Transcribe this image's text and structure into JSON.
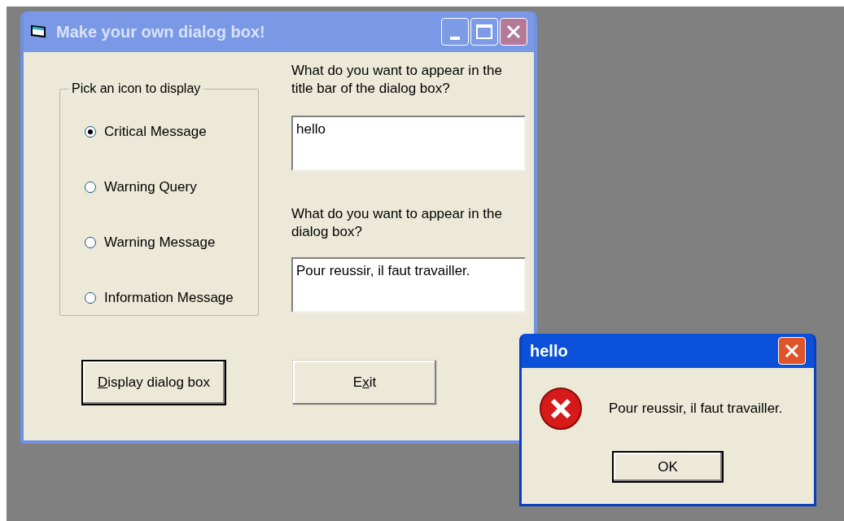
{
  "main_window": {
    "title": "Make your own dialog box!",
    "active": false,
    "group": {
      "legend": "Pick an icon to display",
      "options": [
        {
          "label": "Critical Message",
          "selected": true
        },
        {
          "label": "Warning Query",
          "selected": false
        },
        {
          "label": "Warning Message",
          "selected": false
        },
        {
          "label": "Information Message",
          "selected": false
        }
      ]
    },
    "fields": [
      {
        "label": "What do you want to appear in the title bar of the dialog box?",
        "value": "hello"
      },
      {
        "label": "What do you want to appear in the dialog box?",
        "value": "Pour reussir, il faut travailler."
      }
    ],
    "buttons": [
      {
        "mnemonic": "D",
        "after": "isplay dialog box",
        "default": true
      },
      {
        "before": "E",
        "mnemonic": "x",
        "after": "it",
        "default": false
      }
    ]
  },
  "message_box": {
    "title": "hello",
    "active": true,
    "kind": "critical",
    "message": "Pour reussir, il faut travailler.",
    "button": "OK"
  }
}
